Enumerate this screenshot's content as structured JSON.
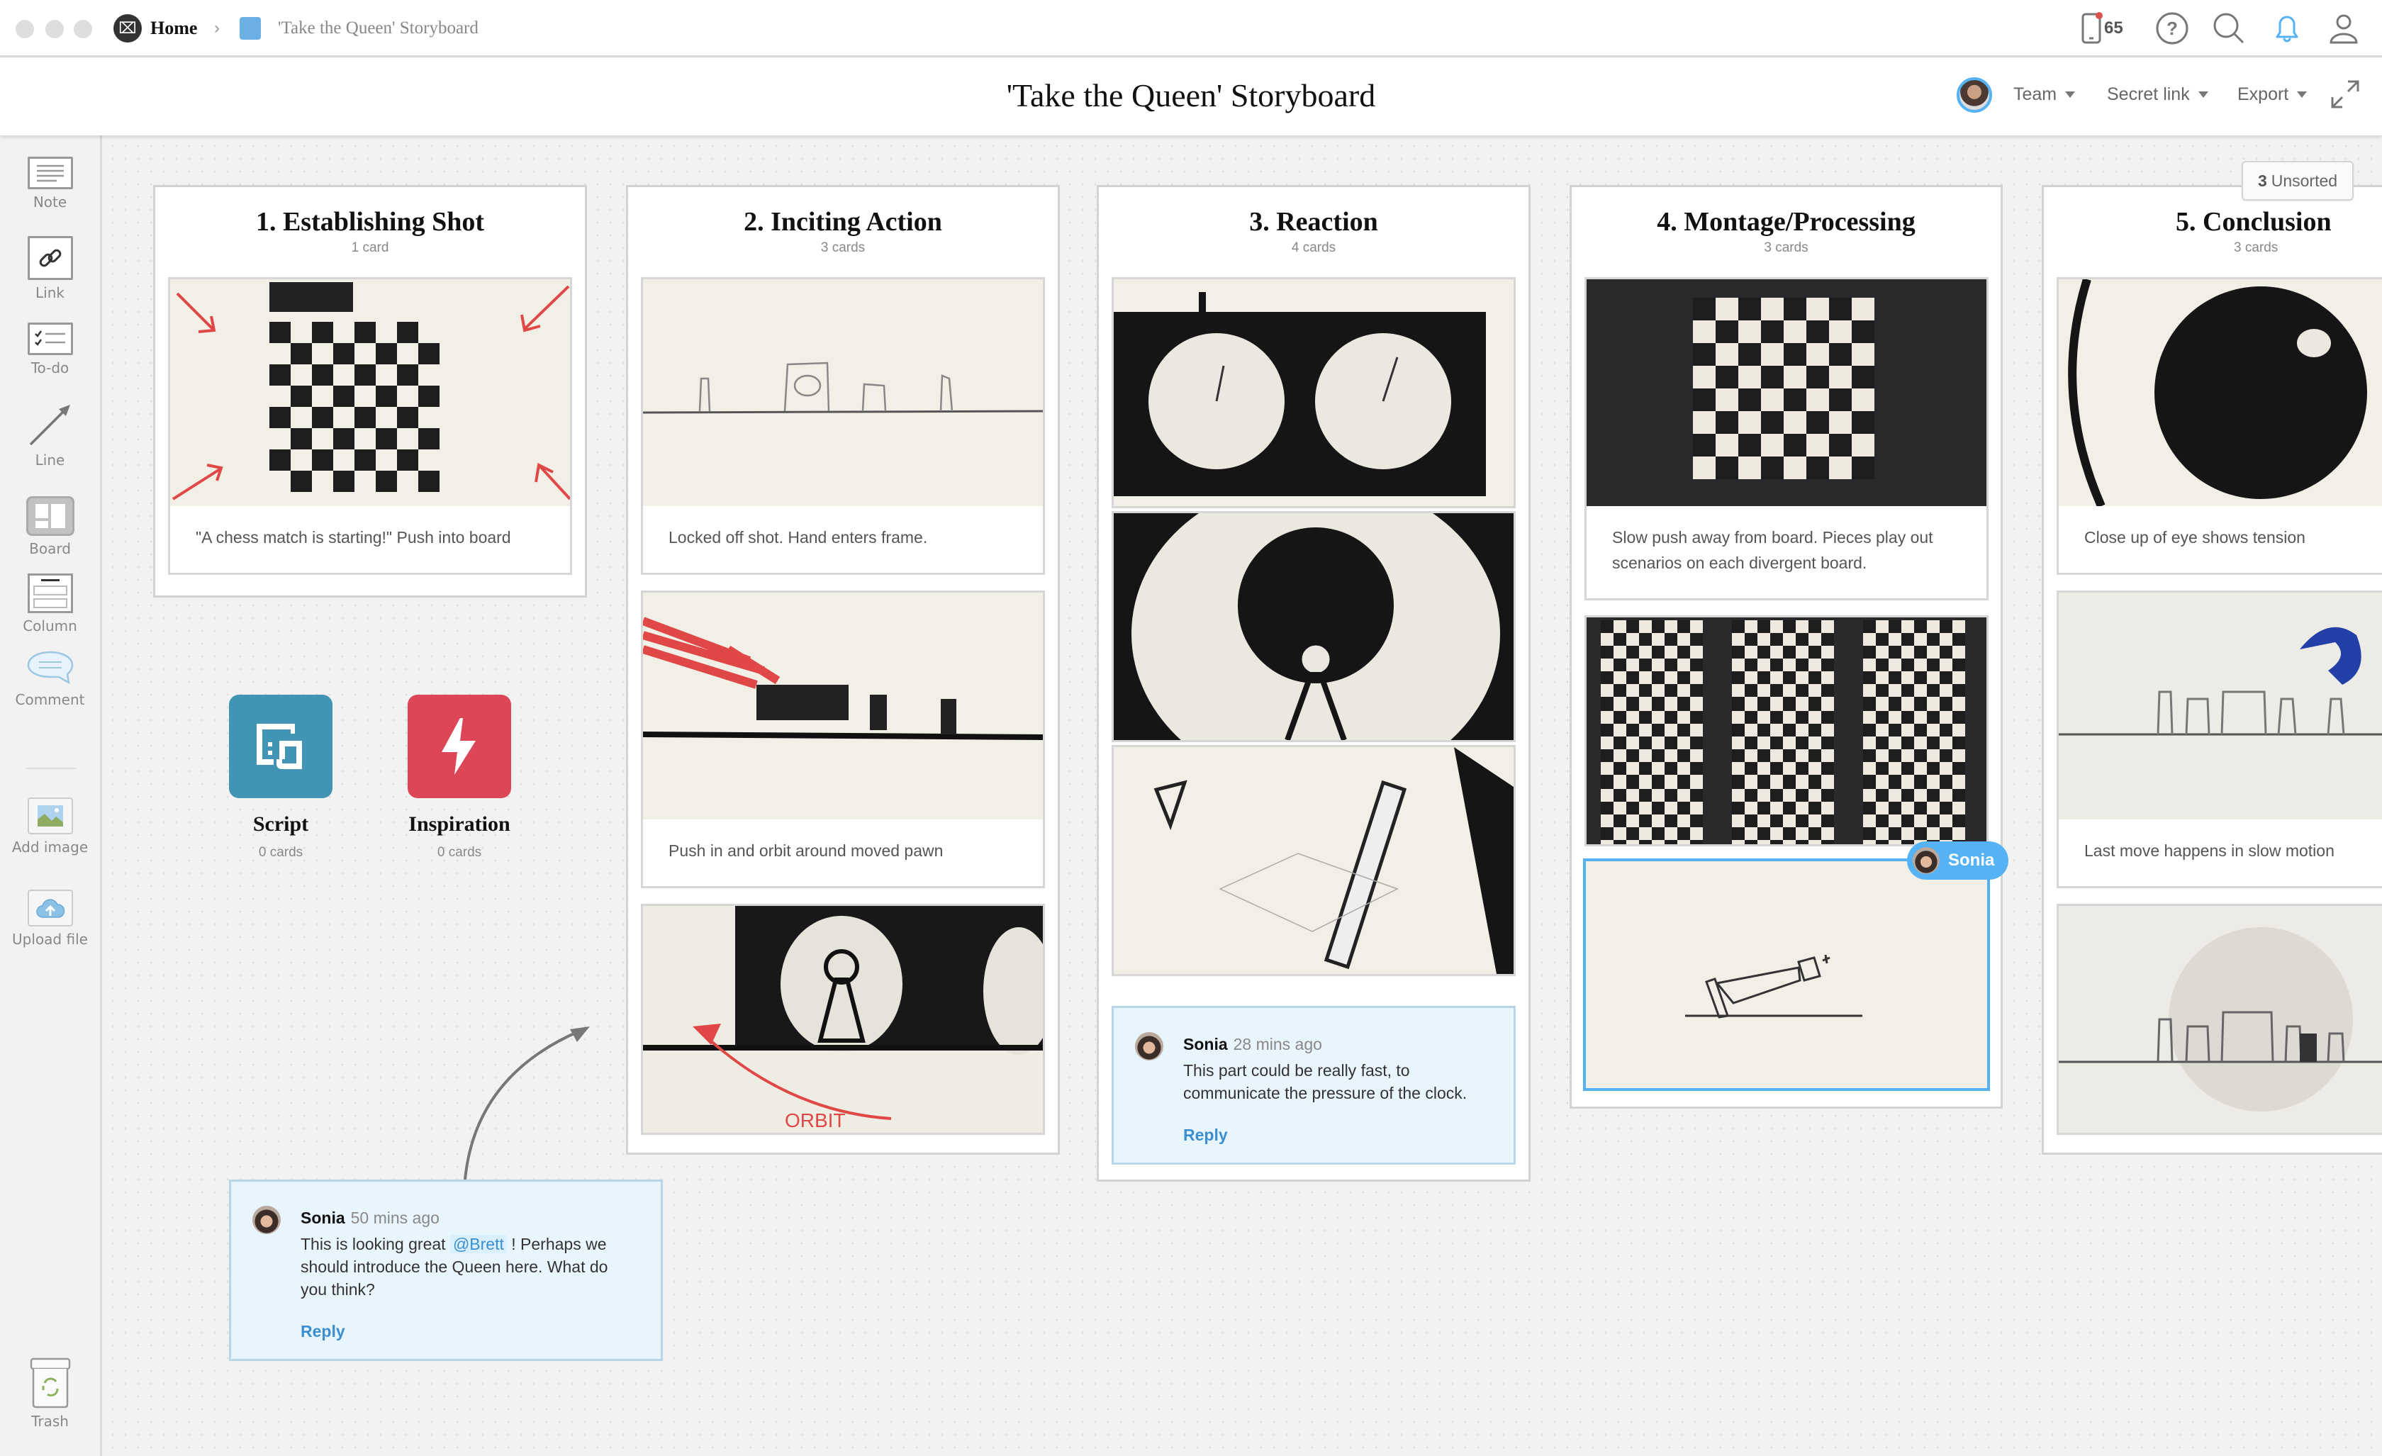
{
  "topbar": {
    "home_label": "Home",
    "breadcrumb_separator": "›",
    "board_name": "'Take the Queen' Storyboard",
    "board_color": "#6bb0e4",
    "device_count": "65",
    "icons": [
      "mobile-device-icon",
      "help-icon",
      "search-icon",
      "notification-bell-icon",
      "user-profile-icon"
    ]
  },
  "titlebar": {
    "title": "'Take the Queen' Storyboard",
    "team_label": "Team",
    "secret_link_label": "Secret link",
    "export_label": "Export"
  },
  "sidebar": {
    "tools": [
      {
        "label": "Note",
        "icon": "note-icon"
      },
      {
        "label": "Link",
        "icon": "link-icon"
      },
      {
        "label": "To-do",
        "icon": "todo-icon"
      },
      {
        "label": "Line",
        "icon": "line-arrow-icon"
      },
      {
        "label": "Board",
        "icon": "board-icon"
      },
      {
        "label": "Column",
        "icon": "column-icon"
      },
      {
        "label": "Comment",
        "icon": "comment-icon"
      },
      {
        "label": "Add image",
        "icon": "add-image-icon"
      },
      {
        "label": "Upload file",
        "icon": "upload-cloud-icon"
      },
      {
        "label": "Trash",
        "icon": "trash-icon"
      }
    ]
  },
  "unsorted": {
    "count": "3",
    "label": "Unsorted"
  },
  "columns": [
    {
      "title": "1. Establishing Shot",
      "count": "1 card",
      "cards": [
        {
          "image": "chessboard-sketch-with-push-in-arrows",
          "caption": "\"A chess match is starting!\" Push into board"
        }
      ]
    },
    {
      "title": "2. Inciting Action",
      "count": "3 cards",
      "cards": [
        {
          "image": "wide-sketch-chess-pieces-horizon",
          "caption": "Locked off shot. Hand enters frame."
        },
        {
          "image": "sketch-red-hand-moving-pawn",
          "caption": "Push in and orbit around moved pawn"
        },
        {
          "image": "sketch-orbit-around-pawn",
          "caption": ""
        }
      ]
    },
    {
      "title": "3. Reaction",
      "count": "4 cards",
      "cards": [
        {
          "image": "sketch-chess-clock",
          "caption": ""
        },
        {
          "image": "sketch-pawn-closeup-dark-circle",
          "caption": ""
        },
        {
          "image": "sketch-diagonal-board-perspective",
          "caption": ""
        }
      ],
      "comment": {
        "author": "Sonia",
        "time": "28 mins ago",
        "text": "This part could be really fast, to communicate the pressure of the clock.",
        "reply_label": "Reply"
      }
    },
    {
      "title": "4. Montage/Processing",
      "count": "3 cards",
      "cards": [
        {
          "image": "sketch-chessboard-dark",
          "caption": "Slow push away from board. Pieces play out scenarios on each divergent board."
        },
        {
          "image": "sketch-multiple-chessboards-grid",
          "caption": ""
        },
        {
          "image": "sketch-falling-king",
          "caption": "",
          "selected": true
        }
      ],
      "cursor": {
        "user": "Sonia",
        "color": "#55b2f4"
      }
    },
    {
      "title": "5. Conclusion",
      "count": "3 cards",
      "cards": [
        {
          "image": "sketch-eye-closeup",
          "caption": "Close up of eye shows tension"
        },
        {
          "image": "sketch-blue-hand-last-move",
          "caption": "Last move happens in slow motion"
        },
        {
          "image": "sketch-pieces-on-board-faded",
          "caption": ""
        }
      ]
    }
  ],
  "boards": [
    {
      "label": "Script",
      "count": "0 cards",
      "color": "#4294b4",
      "icon": "script-document-icon"
    },
    {
      "label": "Inspiration",
      "count": "0 cards",
      "color": "#dc4656",
      "icon": "lightning-bolt-icon"
    }
  ],
  "comment_main": {
    "author": "Sonia",
    "time": "50 mins ago",
    "text_before": "This is looking great ",
    "mention": "@Brett",
    "text_after": " ! Perhaps we should introduce the Queen here. What do you think?",
    "reply_label": "Reply"
  }
}
